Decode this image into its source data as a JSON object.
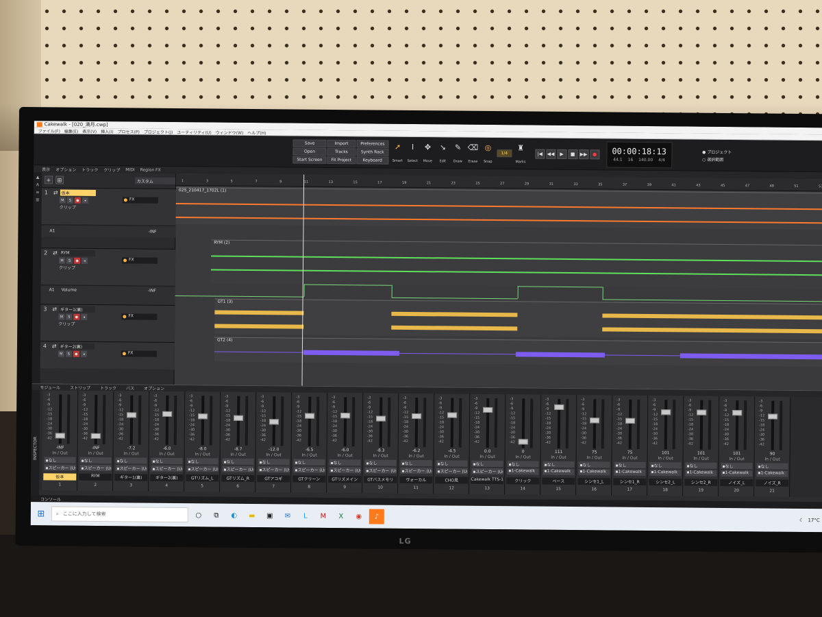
{
  "window": {
    "app": "Cakewalk",
    "title": "Cakewalk - [020_満月.cwp]"
  },
  "menu": [
    "ファイル(F)",
    "編集(E)",
    "表示(V)",
    "挿入(I)",
    "プロセス(P)",
    "プロジェクト(J)",
    "ユーティリティ(U)",
    "ウィンドウ(W)",
    "ヘルプ(H)"
  ],
  "controlbar": {
    "buttons": [
      "Save",
      "Import",
      "Preferences",
      "Open",
      "Tracks",
      "Synth Rack",
      "Start Screen",
      "Fit Project",
      "Keyboard"
    ],
    "tools": [
      "Smart",
      "Select",
      "Move",
      "Edit",
      "Draw",
      "Erase"
    ],
    "snap": {
      "label": "Snap",
      "value": "1/4"
    },
    "marks_label": "Marks",
    "transport": [
      "|◀",
      "◀◀",
      "▶",
      "■",
      "▶▶",
      "●"
    ],
    "clock": {
      "time": "00:00:18:13",
      "sig_a": "44.1",
      "sig_b": "16",
      "tempo": "140.00",
      "meter": "4/4"
    },
    "scope": {
      "project": "プロジェクト",
      "selection": "選択範囲"
    }
  },
  "trackview": {
    "menu": [
      "表示",
      "オプション",
      "トラック",
      "クリップ",
      "MIDI",
      "Region FX"
    ],
    "custom": "カスタム",
    "ruler": [
      "1",
      "3",
      "5",
      "7",
      "9",
      "11",
      "13",
      "15",
      "17",
      "19",
      "21",
      "23",
      "25",
      "27",
      "29",
      "31",
      "33",
      "35",
      "37",
      "39",
      "41",
      "43",
      "45",
      "47",
      "49",
      "51",
      "53"
    ],
    "tracks": [
      {
        "num": "1",
        "name": "仮本",
        "clip": "025_210417_1702L (1)",
        "sub": "クリップ"
      },
      {
        "num": "2",
        "name": "RYM",
        "clip": "RYM (2)",
        "sub": "クリップ"
      },
      {
        "num": "3",
        "name": "ギター1(裏)",
        "clip": "GT1 (3)",
        "sub": "クリップ"
      },
      {
        "num": "4",
        "name": "ギター2(裏)",
        "clip": "GT2 (4)",
        "sub": "クリップ"
      }
    ],
    "lanes": [
      {
        "label": "A1",
        "value": "-INF"
      },
      {
        "label": "A1",
        "value": "-INF",
        "param": "Volume"
      }
    ],
    "fx_label": "FX"
  },
  "console": {
    "menu": [
      "モジュール",
      "ストリップ",
      "トラック",
      "バス",
      "オプション"
    ],
    "inspector": "INSPECTOR",
    "io_label": "In / Out",
    "strips": [
      {
        "num": "1",
        "name": "仮本",
        "val": "-INF",
        "in": "なし",
        "out": "スピーカー (Us"
      },
      {
        "num": "2",
        "name": "RYM",
        "val": "-INF",
        "in": "なし",
        "out": "スピーカー (Us"
      },
      {
        "num": "3",
        "name": "ギター1(裏)",
        "val": "-7.2",
        "in": "なし",
        "out": "スピーカー (Us"
      },
      {
        "num": "4",
        "name": "ギター2(裏)",
        "val": "-6.0",
        "in": "なし",
        "out": "スピーカー (Us"
      },
      {
        "num": "5",
        "name": "GTリズム_L",
        "val": "-8.0",
        "in": "なし",
        "out": "スピーカー (Us"
      },
      {
        "num": "6",
        "name": "GTリズム_R",
        "val": "-8.7",
        "in": "なし",
        "out": "スピーカー (Us"
      },
      {
        "num": "7",
        "name": "GTアコギ",
        "val": "-12.0",
        "in": "なし",
        "out": "スピーカー (Us"
      },
      {
        "num": "8",
        "name": "GTクリーン",
        "val": "-6.5",
        "in": "なし",
        "out": "スピーカー (Us"
      },
      {
        "num": "9",
        "name": "GTリズメイン",
        "val": "-6.0",
        "in": "なし",
        "out": "スピーカー (Us"
      },
      {
        "num": "10",
        "name": "GTバスメモリ",
        "val": "-8.3",
        "in": "なし",
        "out": "スピーカー (Us"
      },
      {
        "num": "11",
        "name": "ヴォーカル",
        "val": "-6.2",
        "in": "なし",
        "out": "スピーカー (Us"
      },
      {
        "num": "12",
        "name": "CHO見",
        "val": "-4.5",
        "in": "なし",
        "out": "スピーカー (Us"
      },
      {
        "num": "13",
        "name": "Cakewalk TTS-1",
        "val": "0.0",
        "in": "なし",
        "out": "スピーカー (Us"
      },
      {
        "num": "14",
        "name": "クリック",
        "val": "0",
        "in": "なし",
        "out": "1-Cakewalk"
      },
      {
        "num": "15",
        "name": "ベース",
        "val": "111",
        "in": "なし",
        "out": "1-Cakewalk"
      },
      {
        "num": "16",
        "name": "シンセ1_L",
        "val": "75",
        "in": "なし",
        "out": "1-Cakewalk"
      },
      {
        "num": "17",
        "name": "シンセ1_R",
        "val": "75",
        "in": "なし",
        "out": "1-Cakewalk"
      },
      {
        "num": "18",
        "name": "シンセ2_L",
        "val": "101",
        "in": "なし",
        "out": "1-Cakewalk"
      },
      {
        "num": "19",
        "name": "シンセ2_R",
        "val": "101",
        "in": "なし",
        "out": "1-Cakewalk"
      },
      {
        "num": "20",
        "name": "ノイズ_L",
        "val": "101",
        "in": "なし",
        "out": "1-Cakewalk"
      },
      {
        "num": "21",
        "name": "ノイズ_R",
        "val": "90",
        "in": "なし",
        "out": "1-Cakewalk"
      }
    ],
    "console_tab": "コンソール"
  },
  "taskbar": {
    "search_placeholder": "ここに入力して検索",
    "temp": "17°C",
    "brand": "LG"
  },
  "colors": {
    "orange": "#ff7a2e",
    "green": "#5fe05a",
    "yellow": "#e8b84a",
    "purple": "#7f5cf0"
  }
}
